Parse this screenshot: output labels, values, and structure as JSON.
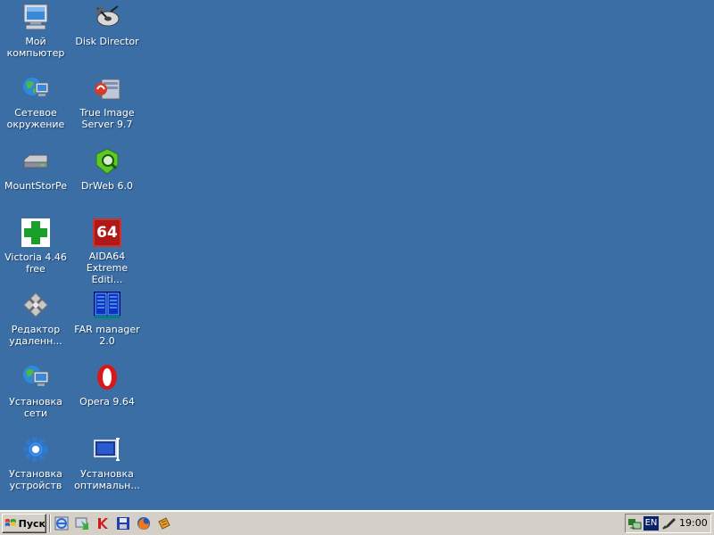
{
  "desktop": {
    "icons": [
      {
        "label": "Мой\nкомпьютер",
        "icon": "my-computer-icon"
      },
      {
        "label": "Disk Director",
        "icon": "disk-director-icon"
      },
      {
        "label": "Сетевое\nокружение",
        "icon": "network-places-icon"
      },
      {
        "label": "True Image\nServer 9.7",
        "icon": "true-image-icon"
      },
      {
        "label": "MountStorPe",
        "icon": "drive-icon"
      },
      {
        "label": "DrWeb 6.0",
        "icon": "drweb-icon"
      },
      {
        "label": "Victoria 4.46\nfree",
        "icon": "victoria-icon"
      },
      {
        "label": "AIDA64\nExtreme Editi...",
        "icon": "aida64-icon",
        "badge": "64"
      },
      {
        "label": "Редактор\nудаленн...",
        "icon": "remote-editor-icon"
      },
      {
        "label": "FAR manager\n2.0",
        "icon": "far-manager-icon"
      },
      {
        "label": "Установка\nсети",
        "icon": "network-setup-icon"
      },
      {
        "label": "Opera 9.64",
        "icon": "opera-icon"
      },
      {
        "label": "Установка\nустройств",
        "icon": "device-setup-icon"
      },
      {
        "label": "Установка\nоптимальн...",
        "icon": "display-setup-icon"
      }
    ]
  },
  "taskbar": {
    "start_label": "Пуск",
    "quick_launch": [
      "ie-icon",
      "download-icon",
      "kaspersky-icon",
      "save-icon",
      "firefox-icon",
      "toolbox-icon"
    ],
    "tray": {
      "language": "EN",
      "clock": "19:00"
    }
  },
  "colors": {
    "desktop_bg": "#3a6ea5",
    "taskbar_bg": "#d4d0c8"
  }
}
